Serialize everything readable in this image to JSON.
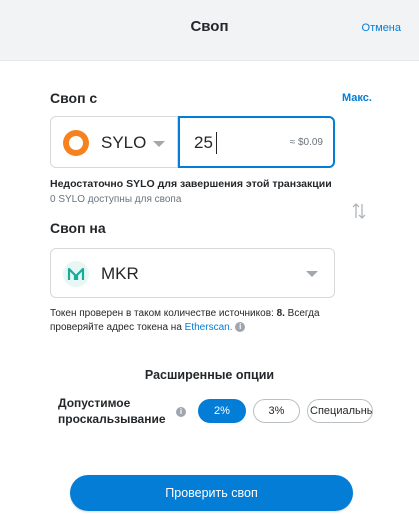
{
  "header": {
    "title": "Своп",
    "cancel_label": "Отмена"
  },
  "from": {
    "label": "Своп с",
    "max_label": "Макс.",
    "token": "SYLO",
    "token_icon": "sylo-logo-icon",
    "amount": "25",
    "fiat": "≈ $0.09",
    "error": "Недостаточно SYLO для завершения этой транзакции",
    "available": "0 SYLO доступны для свопа"
  },
  "to": {
    "label": "Своп на",
    "token": "MKR",
    "token_icon": "mkr-logo-icon",
    "verify_text_1": "Токен проверен в таком количестве источников: ",
    "verify_count": "8.",
    "verify_text_1b": " Всегда",
    "verify_text_2": "проверяйте адрес токена на ",
    "verify_link": "Etherscan."
  },
  "advanced": {
    "title": "Расширенные опции",
    "slippage_label_1": "Допустимое",
    "slippage_label_2": "проскальзывание",
    "options": [
      "2%",
      "3%",
      "Специальный"
    ],
    "selected": "2%"
  },
  "footer": {
    "review_button": "Проверить своп"
  },
  "colors": {
    "accent": "#037dd6",
    "sylo": "#f5821f",
    "mkr": "#1aab9b"
  }
}
